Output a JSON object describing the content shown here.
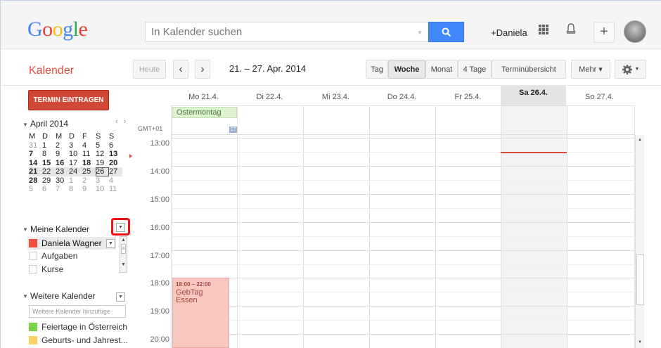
{
  "header": {
    "logo": "Google",
    "search_placeholder": "In Kalender suchen",
    "user_link": "+Daniela"
  },
  "toolbar": {
    "app_name": "Kalender",
    "today": "Heute",
    "prev": "‹",
    "next": "›",
    "date_range": "21. – 27. Apr. 2014",
    "views": [
      "Tag",
      "Woche",
      "Monat",
      "4 Tage",
      "Terminübersicht"
    ],
    "active_view": "Woche",
    "more": "Mehr ▾"
  },
  "sidebar": {
    "create_button": "TERMIN EINTRAGEN",
    "mini_calendar": {
      "month": "April 2014",
      "weekdays": [
        "M",
        "D",
        "M",
        "D",
        "F",
        "S",
        "S"
      ],
      "weeks": [
        [
          "31",
          "1",
          "2",
          "3",
          "4",
          "5",
          "6"
        ],
        [
          "7",
          "8",
          "9",
          "10",
          "11",
          "12",
          "13"
        ],
        [
          "14",
          "15",
          "16",
          "17",
          "18",
          "19",
          "20"
        ],
        [
          "21",
          "22",
          "23",
          "24",
          "25",
          "26",
          "27"
        ],
        [
          "28",
          "29",
          "30",
          "1",
          "2",
          "3",
          "4"
        ],
        [
          "5",
          "6",
          "7",
          "8",
          "9",
          "10",
          "11"
        ]
      ]
    },
    "my_calendars": {
      "title": "Meine Kalender",
      "items": [
        "Daniela Wagner",
        "Aufgaben",
        "Kurse"
      ],
      "colors": [
        "#f2503c",
        "",
        ""
      ]
    },
    "other_calendars": {
      "title": "Weitere Kalender",
      "add_placeholder": "Weitere Kalender hinzufüge",
      "items": [
        "Feiertage in Österreich",
        "Geburts- und Jahrest..."
      ],
      "colors": [
        "#7bd148",
        "#fad165"
      ]
    }
  },
  "week": {
    "timezone": "GMT+01",
    "days": [
      "Mo 21.4.",
      "Di 22.4.",
      "Mi 23.4.",
      "Do 24.4.",
      "Fr 25.4.",
      "Sa 26.4.",
      "So 27.4."
    ],
    "today_index": 5,
    "hours": [
      "13:00",
      "14:00",
      "15:00",
      "16:00",
      "17:00",
      "18:00",
      "19:00",
      "20:00"
    ],
    "allday_event": "Ostermontag",
    "event": {
      "time": "18:00 – 22:00",
      "title_line1": "GebTag",
      "title_line2": "Essen"
    }
  },
  "colors": {
    "accent_red": "#dd4b39",
    "search_blue": "#4387fd",
    "event_bg": "#f8c7c0",
    "allday_bg": "#dff2d4"
  }
}
